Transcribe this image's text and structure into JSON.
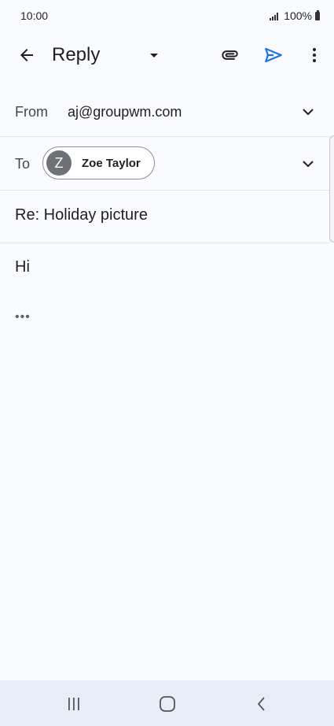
{
  "status_bar": {
    "time": "10:00",
    "battery": "100%"
  },
  "toolbar": {
    "title": "Reply",
    "back_icon": "arrow-back-icon",
    "dropdown_icon": "caret-down-icon",
    "attach_icon": "paperclip-icon",
    "send_icon": "send-icon",
    "more_icon": "more-vert-icon",
    "send_color": "#1a73e8"
  },
  "from": {
    "label": "From",
    "value": "aj@groupwm.com"
  },
  "to": {
    "label": "To",
    "recipient": {
      "initial": "Z",
      "name": "Zoe Taylor"
    }
  },
  "subject": "Re: Holiday picture",
  "body": "Hi",
  "quoted_toggle": "•••",
  "nav_bar": {
    "items": [
      "recents-icon",
      "home-icon",
      "back-icon"
    ]
  }
}
